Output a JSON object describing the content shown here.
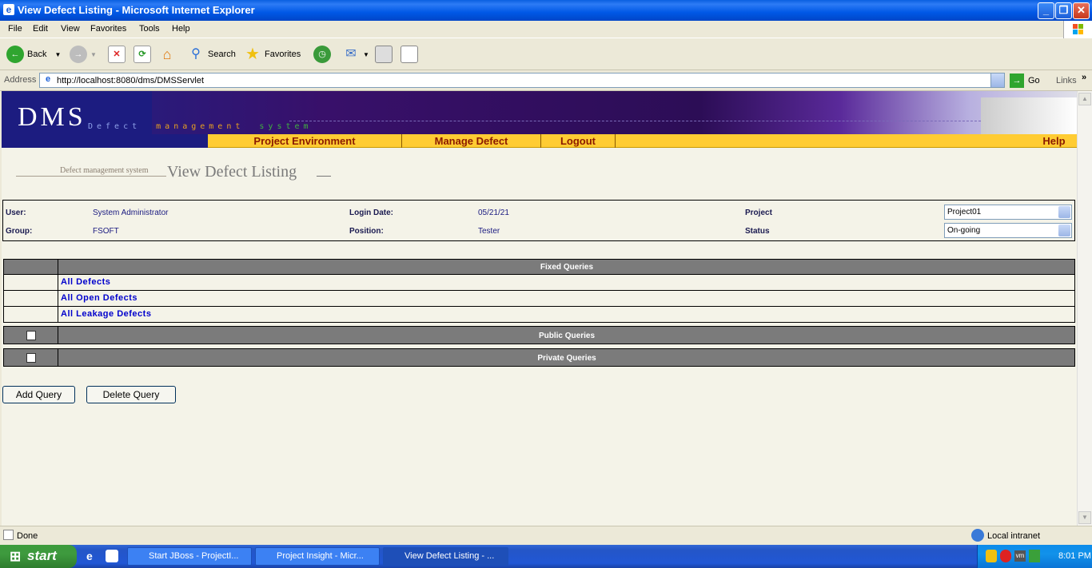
{
  "window": {
    "title": "View Defect Listing - Microsoft Internet Explorer"
  },
  "menu": [
    "File",
    "Edit",
    "View",
    "Favorites",
    "Tools",
    "Help"
  ],
  "toolbar": {
    "back": "Back",
    "search": "Search",
    "favorites": "Favorites"
  },
  "address": {
    "label": "Address",
    "url": "http://localhost:8080/dms/DMSServlet",
    "go": "Go",
    "links": "Links"
  },
  "banner": {
    "logo": "DMS",
    "sub_defect": "Defect",
    "sub_management": "management",
    "sub_system": "system"
  },
  "nav": {
    "project_environment": "Project Environment",
    "manage_defect": "Manage Defect",
    "logout": "Logout",
    "help": "Help"
  },
  "page": {
    "crumb": "Defect management system",
    "heading": "View Defect Listing"
  },
  "user_info": {
    "user_label": "User:",
    "user_value": "System Administrator",
    "group_label": "Group:",
    "group_value": "FSOFT",
    "login_date_label": "Login Date:",
    "login_date_value": "05/21/21",
    "position_label": "Position:",
    "position_value": "Tester",
    "project_label": "Project",
    "project_value": "Project01",
    "status_label": "Status",
    "status_value": "On-going"
  },
  "queries": {
    "fixed_title": "Fixed Queries",
    "fixed_items": [
      "All Defects",
      "All Open Defects",
      "All Leakage Defects"
    ],
    "public_title": "Public Queries",
    "private_title": "Private Queries"
  },
  "buttons": {
    "add_query": "Add Query",
    "delete_query": "Delete Query"
  },
  "statusbar": {
    "status": "Done",
    "zone": "Local intranet"
  },
  "taskbar": {
    "start": "start",
    "tasks": [
      "Start JBoss - ProjectI...",
      "Project Insight - Micr...",
      "View Defect Listing - ..."
    ],
    "clock": "8:01 PM"
  },
  "colors": {
    "nav_bg": "#FFCC33",
    "nav_text": "#8B1A00",
    "query_header": "#7B7B7B",
    "link": "#0000CC"
  }
}
